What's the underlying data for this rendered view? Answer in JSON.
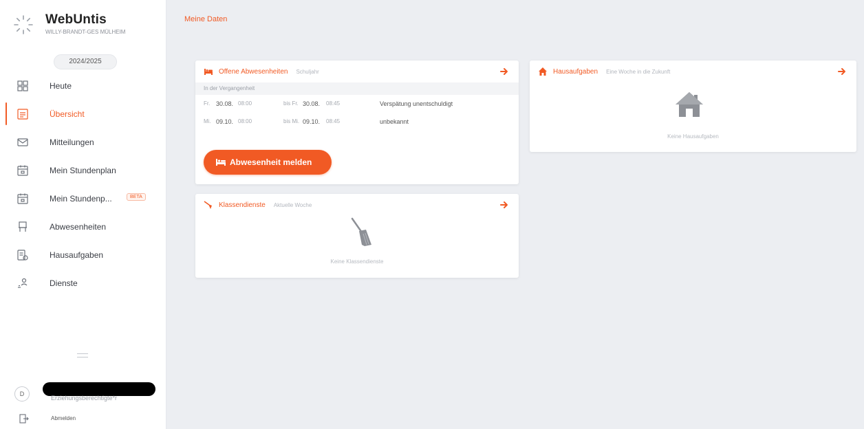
{
  "app": {
    "name": "WebUntis",
    "school": "WILLY-BRANDT-GES MÜLHEIM",
    "school_year": "2024/2025"
  },
  "colors": {
    "accent": "#f15a24",
    "sidebar_bg": "#ffffff",
    "main_bg": "#eceef2"
  },
  "nav": {
    "items": [
      {
        "label": "Heute",
        "icon": "dashboard-icon",
        "active": false
      },
      {
        "label": "Übersicht",
        "icon": "overview-icon",
        "active": true
      },
      {
        "label": "Mitteilungen",
        "icon": "message-icon",
        "active": false
      },
      {
        "label": "Mein Stundenplan",
        "icon": "calendar-icon",
        "active": false
      },
      {
        "label": "Mein Stundenp...",
        "icon": "calendar-icon",
        "active": false,
        "badge": "BETA"
      },
      {
        "label": "Abwesenheiten",
        "icon": "absence-icon",
        "active": false
      },
      {
        "label": "Hausaufgaben",
        "icon": "homework-icon",
        "active": false
      },
      {
        "label": "Dienste",
        "icon": "services-icon",
        "active": false
      }
    ]
  },
  "user": {
    "avatar_initial": "D",
    "role": "Erziehungsberechtigte*r",
    "logout_label": "Abmelden"
  },
  "page": {
    "title": "Meine Daten"
  },
  "absences_card": {
    "title": "Offene Abwesenheiten",
    "subtitle": "Schuljahr",
    "section": "In der Vergangenheit",
    "rows": [
      {
        "from_day": "Fr.",
        "from_date": "30.08.",
        "from_time": "08:00",
        "to_day": "bis Fr.",
        "to_date": "30.08.",
        "to_time": "08:45",
        "reason": "Verspätung unentschuldigt"
      },
      {
        "from_day": "Mi.",
        "from_date": "09.10.",
        "from_time": "08:00",
        "to_day": "bis Mi.",
        "to_date": "09.10.",
        "to_time": "08:45",
        "reason": "unbekannt"
      }
    ],
    "button_label": "Abwesenheit melden"
  },
  "homework_card": {
    "title": "Hausaufgaben",
    "subtitle": "Eine Woche in die Zukunft",
    "empty_text": "Keine Hausaufgaben"
  },
  "class_services_card": {
    "title": "Klassendienste",
    "subtitle": "Aktuelle Woche",
    "empty_text": "Keine Klassendienste"
  }
}
